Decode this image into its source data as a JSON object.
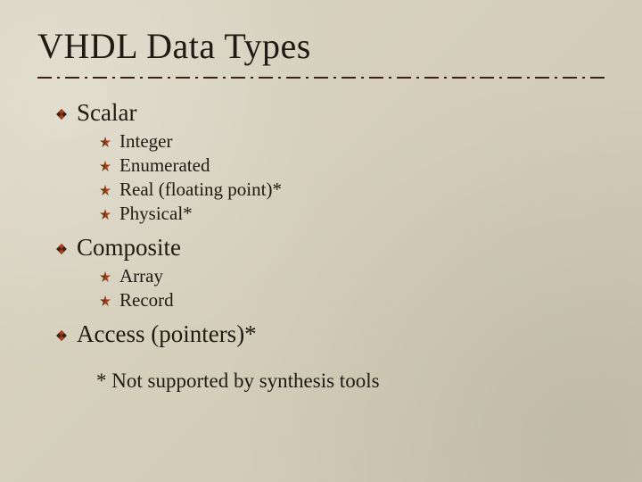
{
  "title": "VHDL Data Types",
  "sections": [
    {
      "label": "Scalar",
      "items": [
        "Integer",
        "Enumerated",
        "Real (floating point)*",
        "Physical*"
      ]
    },
    {
      "label": "Composite",
      "items": [
        "Array",
        "Record"
      ]
    },
    {
      "label": "Access (pointers)*",
      "items": []
    }
  ],
  "footnote": "*  Not supported by synthesis tools",
  "colors": {
    "bullet_dark": "#3b2414",
    "bullet_accent": "#b03a1a",
    "divider": "#3b2414"
  }
}
